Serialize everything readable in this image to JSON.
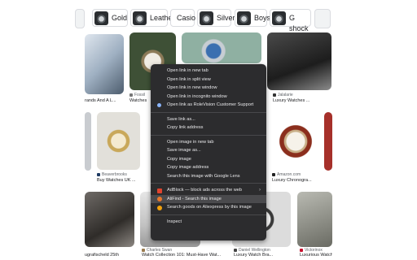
{
  "chips": [
    {
      "label": "Gold"
    },
    {
      "label": "Leather"
    },
    {
      "label": "Casio"
    },
    {
      "label": "Silver"
    },
    {
      "label": "Boys"
    },
    {
      "label": "G shock"
    }
  ],
  "results": [
    {
      "caption": "rands And A L...",
      "source": ""
    },
    {
      "caption": "Watches",
      "source": "Fossil"
    },
    {
      "caption": "",
      "source": ""
    },
    {
      "caption": "Luxury Watches ...",
      "source": "Jalalarie"
    },
    {
      "caption": "Buy Watches UK ...",
      "source": "Beaverbrooks"
    },
    {
      "caption": "Luxury Chronogra...",
      "source": "Amazon.com"
    },
    {
      "caption": "ugrafischeld 25th",
      "source": ""
    },
    {
      "caption": "Watch Collection 101: Must-Have Wat...",
      "source": "Charles Swan"
    },
    {
      "caption": "Luxury Watch Bra...",
      "source": "Daniel Wellington"
    },
    {
      "caption": "Luxurious Watch...",
      "source": "Victorinox"
    }
  ],
  "context_menu": {
    "open_new_tab": "Open link in new tab",
    "open_split_view": "Open link in split view",
    "open_new_window": "Open link in new window",
    "open_incognito": "Open link in incognito window",
    "open_as_profile": "Open link as RoleVision Customer Support",
    "save_link_as": "Save link as...",
    "copy_link": "Copy link address",
    "open_image_new_tab": "Open image in new tab",
    "save_image_as": "Save image as...",
    "copy_image": "Copy image",
    "copy_image_address": "Copy image address",
    "search_image_lens": "Search this image with Google Lens",
    "adblock": "AdBlock — block ads across the web",
    "alifind": "AliFind - Search this image",
    "aliexpress": "Search goods on Aliexpress by this image",
    "inspect": "Inspect",
    "submenu_arrow": "›"
  },
  "icons": {
    "adblock": "adblock-icon",
    "alifind": "alifind-icon",
    "aliexpress": "aliexpress-icon",
    "profile": "profile-icon"
  },
  "colors": {
    "menu_bg": "#2c2c2e",
    "menu_highlight": "#4a4a4d",
    "adblock": "#e0442f",
    "alifind": "#e8762c",
    "aliexpress": "#f2a10c"
  }
}
